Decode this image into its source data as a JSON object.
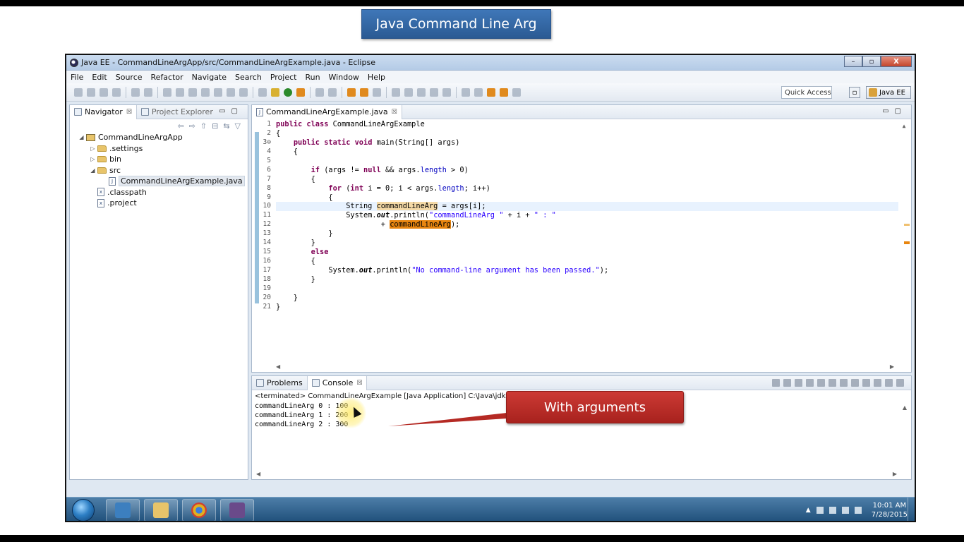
{
  "slide": {
    "title": "Java Command Line Arg",
    "callout": "With arguments"
  },
  "window": {
    "title": "Java EE - CommandLineArgApp/src/CommandLineArgExample.java - Eclipse",
    "minimize": "–",
    "maximize": "▫",
    "close": "X"
  },
  "menu": {
    "items": [
      "File",
      "Edit",
      "Source",
      "Refactor",
      "Navigate",
      "Search",
      "Project",
      "Run",
      "Window",
      "Help"
    ]
  },
  "toolbar": {
    "quick_access": "Quick Access",
    "perspective": "Java EE"
  },
  "navigator": {
    "tab_navigator": "Navigator",
    "tab_project_explorer": "Project Explorer",
    "close_glyph": "☒",
    "tree": [
      {
        "label": "CommandLineArgApp",
        "indent": 0,
        "toggle": "◢",
        "icon": "project"
      },
      {
        "label": ".settings",
        "indent": 1,
        "toggle": "▷",
        "icon": "folder"
      },
      {
        "label": "bin",
        "indent": 1,
        "toggle": "▷",
        "icon": "folder"
      },
      {
        "label": "src",
        "indent": 1,
        "toggle": "◢",
        "icon": "folder"
      },
      {
        "label": "CommandLineArgExample.java",
        "indent": 2,
        "toggle": "",
        "icon": "java",
        "selected": true
      },
      {
        "label": ".classpath",
        "indent": 1,
        "toggle": "",
        "icon": "xml"
      },
      {
        "label": ".project",
        "indent": 1,
        "toggle": "",
        "icon": "xml"
      }
    ]
  },
  "editor": {
    "tab_label": "CommandLineArgExample.java",
    "close_glyph": "☒",
    "line_numbers": [
      "1",
      "2",
      "3⊖",
      "4",
      "5",
      "6",
      "7",
      "8",
      "9",
      "10",
      "11",
      "12",
      "13",
      "14",
      "15",
      "16",
      "17",
      "18",
      "19",
      "20",
      "21"
    ],
    "lines": [
      [
        {
          "t": "public class ",
          "c": "kw"
        },
        {
          "t": "CommandLineArgExample"
        }
      ],
      [
        {
          "t": "{"
        }
      ],
      [
        {
          "t": "    "
        },
        {
          "t": "public static void ",
          "c": "kw"
        },
        {
          "t": "main(String[] args)"
        }
      ],
      [
        {
          "t": "    {"
        }
      ],
      [
        {
          "t": ""
        }
      ],
      [
        {
          "t": "        "
        },
        {
          "t": "if ",
          "c": "kw"
        },
        {
          "t": "(args != "
        },
        {
          "t": "null",
          "c": "kw"
        },
        {
          "t": " && args."
        },
        {
          "t": "length",
          "c": "fld"
        },
        {
          "t": " > 0)"
        }
      ],
      [
        {
          "t": "        {"
        }
      ],
      [
        {
          "t": "            "
        },
        {
          "t": "for ",
          "c": "kw"
        },
        {
          "t": "("
        },
        {
          "t": "int ",
          "c": "kw"
        },
        {
          "t": "i = 0; i < args."
        },
        {
          "t": "length",
          "c": "fld"
        },
        {
          "t": "; i++)"
        }
      ],
      [
        {
          "t": "            {"
        }
      ],
      [
        {
          "t": "                String "
        },
        {
          "t": "commandLineArg",
          "c": "occ"
        },
        {
          "t": " = args[i];"
        }
      ],
      [
        {
          "t": "                System."
        },
        {
          "t": "out",
          "c": "it"
        },
        {
          "t": ".println("
        },
        {
          "t": "\"commandLineArg \"",
          "c": "st"
        },
        {
          "t": " + i + "
        },
        {
          "t": "\" : \"",
          "c": "st"
        }
      ],
      [
        {
          "t": "                        + "
        },
        {
          "t": "commandLineArg",
          "c": "occ2"
        },
        {
          "t": ");"
        }
      ],
      [
        {
          "t": "            }"
        }
      ],
      [
        {
          "t": "        }"
        }
      ],
      [
        {
          "t": "        "
        },
        {
          "t": "else",
          "c": "kw"
        }
      ],
      [
        {
          "t": "        {"
        }
      ],
      [
        {
          "t": "            System."
        },
        {
          "t": "out",
          "c": "it"
        },
        {
          "t": ".println("
        },
        {
          "t": "\"No command-line argument has been passed.\"",
          "c": "st"
        },
        {
          "t": ");"
        }
      ],
      [
        {
          "t": "        }"
        }
      ],
      [
        {
          "t": ""
        }
      ],
      [
        {
          "t": "    }"
        }
      ],
      [
        {
          "t": "}"
        }
      ]
    ],
    "highlight_line": 10
  },
  "console": {
    "tab_problems": "Problems",
    "tab_console": "Console",
    "close_glyph": "☒",
    "header": "<terminated> CommandLineArgExample [Java Application] C:\\Java\\jdk1.8.0_4",
    "output": [
      "commandLineArg 0 : 100",
      "commandLineArg 1 : 200",
      "commandLineArg 2 : 300"
    ]
  },
  "taskbar": {
    "clock_time": "10:01 AM",
    "clock_date": "7/28/2015"
  },
  "colors": {
    "slide_title": "#2b5a93",
    "callout": "#b52a24",
    "keyword": "#7f0055",
    "string": "#2a00ff"
  }
}
